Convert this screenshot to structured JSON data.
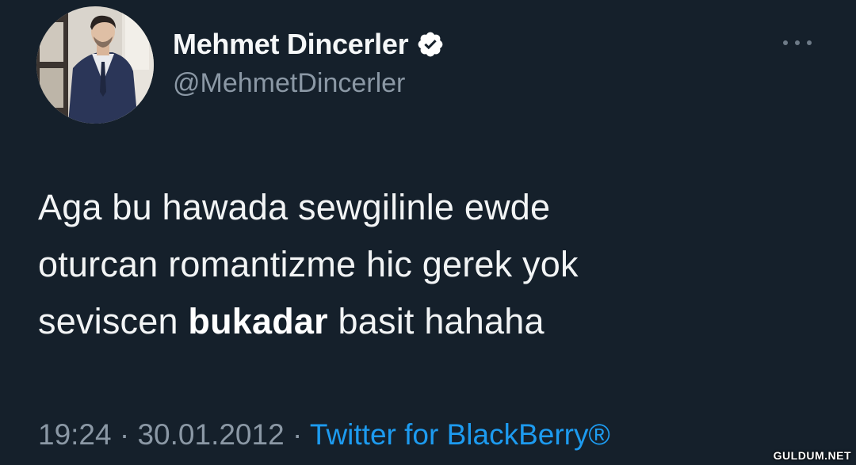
{
  "author": {
    "display_name": "Mehmet Dincerler",
    "handle": "@MehmetDincerler",
    "avatar_icon": "profile-photo",
    "verified_icon": "verified-badge-icon"
  },
  "tweet": {
    "line1": "Aga bu hawada sewgilinle ewde",
    "line2": "oturcan romantizme hic gerek yok",
    "line3_before": "seviscen ",
    "line3_bold": "bukadar",
    "line3_after": " basit hahaha"
  },
  "meta": {
    "time": "19:24",
    "separator": " · ",
    "date": "30.01.2012",
    "source": "Twitter for BlackBerry®"
  },
  "more_icon": "more-dots-icon",
  "watermark": "GULDUM.NET",
  "colors": {
    "background": "#15202b",
    "link": "#1d9bf0",
    "muted": "#8b98a5"
  }
}
